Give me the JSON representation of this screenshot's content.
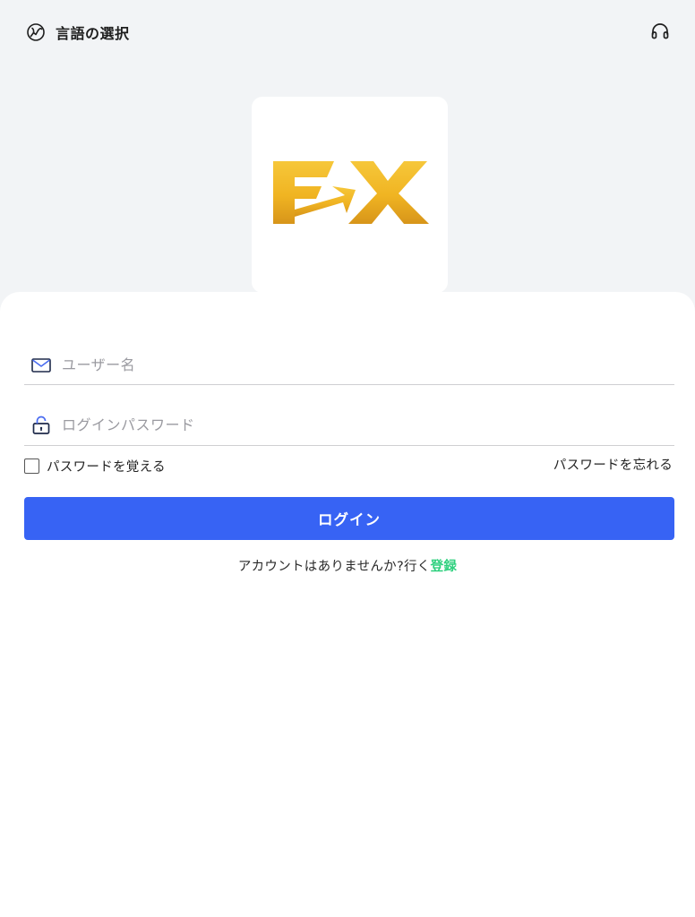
{
  "header": {
    "language_label": "言語の選択",
    "language_icon": "language-globe-icon",
    "support_icon": "headset-icon"
  },
  "logo": {
    "text": "FX",
    "color": "#f0b92a"
  },
  "form": {
    "username_placeholder": "ユーザー名",
    "password_placeholder": "ログインパスワード",
    "username_icon": "mail-icon",
    "password_icon": "lock-icon",
    "remember_label": "パスワードを覚える",
    "remember_checked": false,
    "forgot_label": "パスワードを忘れる",
    "login_label": "ログイン"
  },
  "register": {
    "prompt": "アカウントはありませんか?行く",
    "link_label": "登録"
  },
  "colors": {
    "primary": "#3763f4",
    "link_green": "#2ed07e",
    "background": "#f2f4f6"
  }
}
